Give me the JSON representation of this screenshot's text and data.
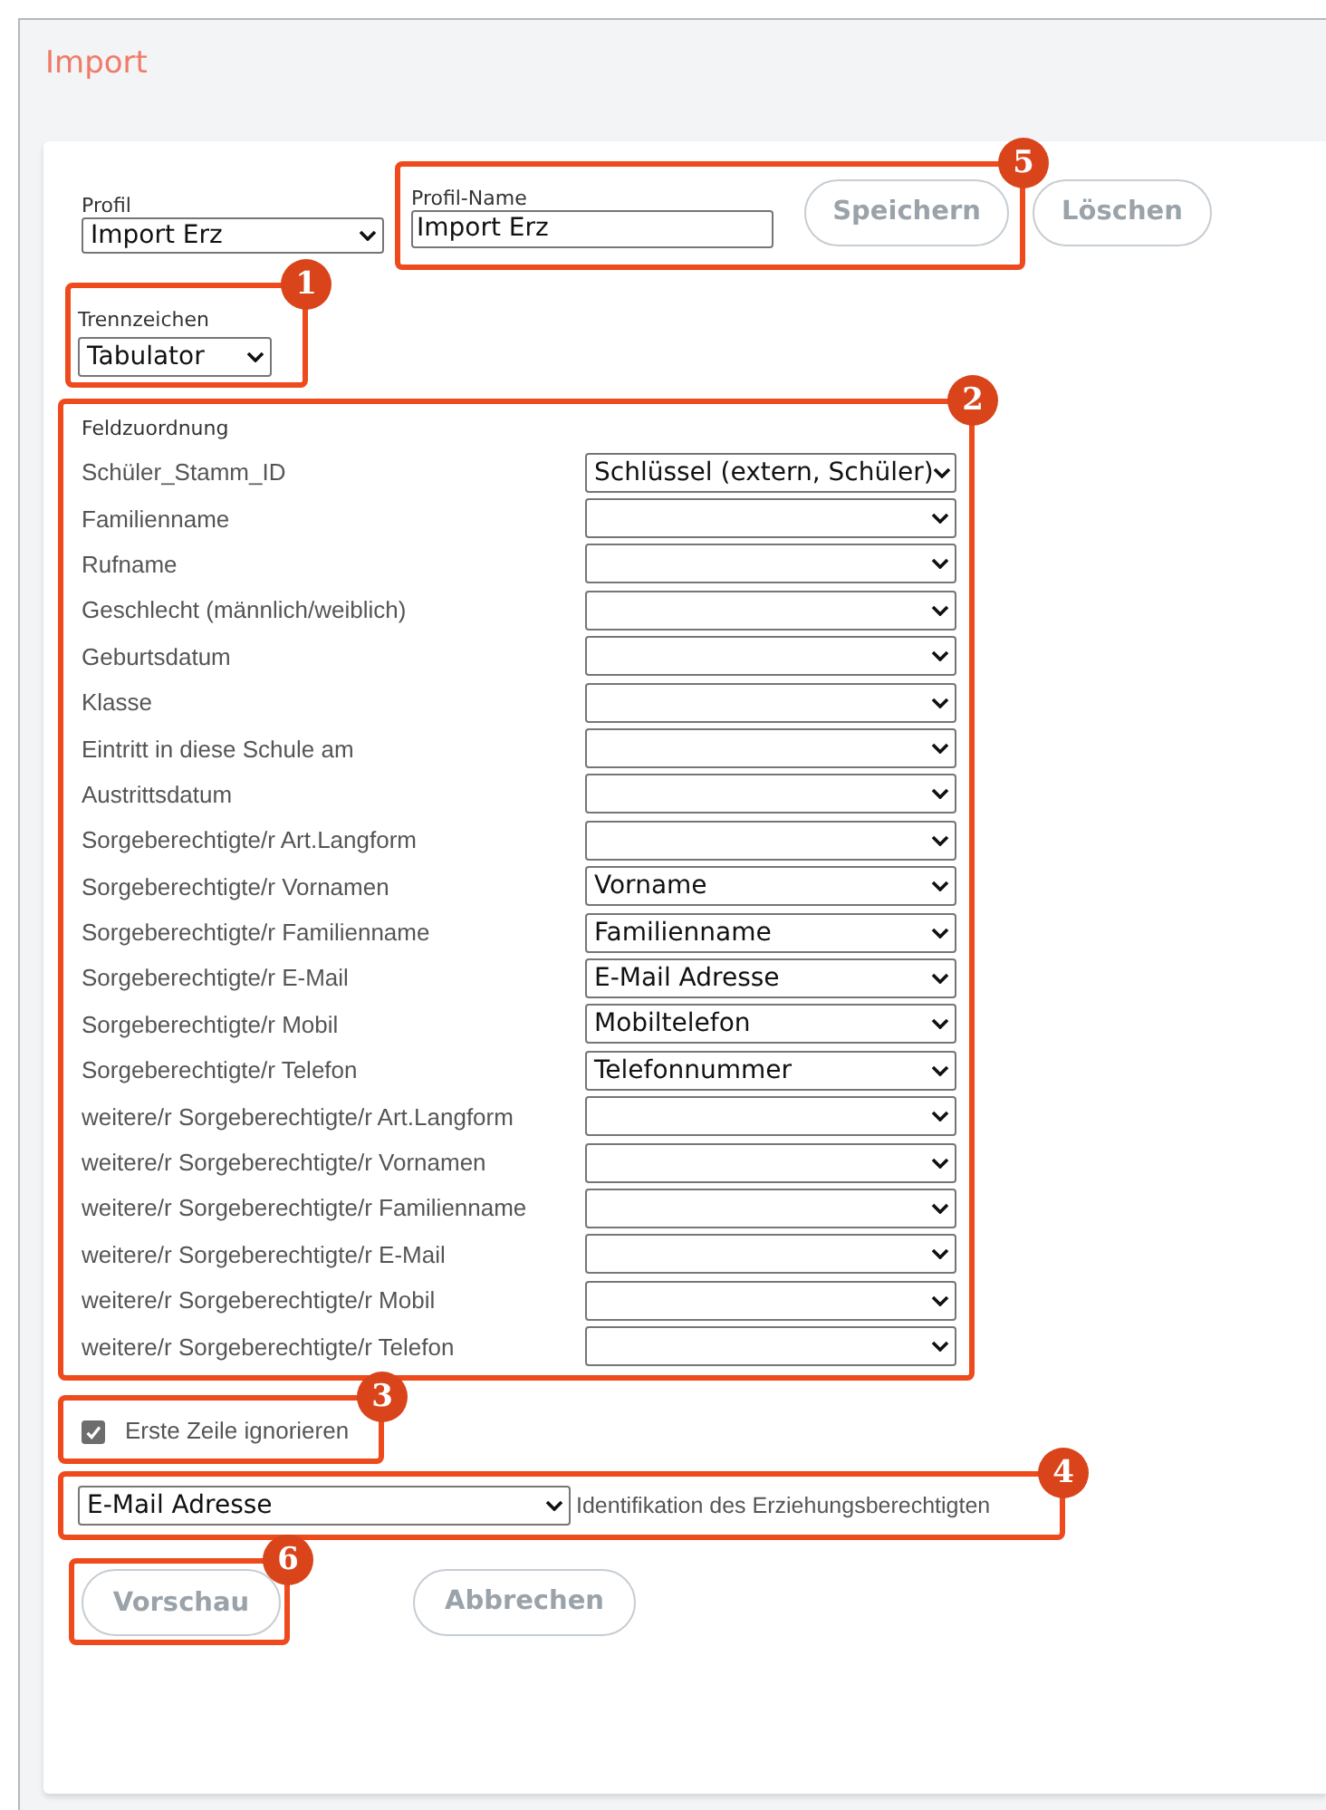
{
  "title": "Import",
  "profile": {
    "label": "Profil",
    "value": "Import Erz"
  },
  "profile_name": {
    "callout": "5",
    "label": "Profil-Name",
    "value": "Import Erz",
    "button": "Speichern"
  },
  "delete_button": "Löschen",
  "separator": {
    "callout": "1",
    "label": "Trennzeichen",
    "value": "Tabulator"
  },
  "field_mapping": {
    "callout": "2",
    "title": "Feldzuordnung",
    "rows": [
      {
        "label": "Schüler_Stamm_ID",
        "value": "Schlüssel (extern, Schüler)"
      },
      {
        "label": "Familienname"
      },
      {
        "label": "Rufname"
      },
      {
        "label": "Geschlecht (männlich/weiblich)"
      },
      {
        "label": "Geburtsdatum"
      },
      {
        "label": "Klasse"
      },
      {
        "label": "Eintritt in diese Schule am"
      },
      {
        "label": "Austrittsdatum"
      },
      {
        "label": "Sorgeberechtigte/r Art.Langform"
      },
      {
        "label": "Sorgeberechtigte/r Vornamen",
        "value": "Vorname"
      },
      {
        "label": "Sorgeberechtigte/r Familienname",
        "value": "Familienname"
      },
      {
        "label": "Sorgeberechtigte/r E-Mail",
        "value": "E-Mail Adresse"
      },
      {
        "label": "Sorgeberechtigte/r Mobil",
        "value": "Mobiltelefon"
      },
      {
        "label": "Sorgeberechtigte/r Telefon",
        "value": "Telefonnummer"
      },
      {
        "label": "weitere/r Sorgeberechtigte/r Art.Langform"
      },
      {
        "label": "weitere/r Sorgeberechtigte/r Vornamen"
      },
      {
        "label": "weitere/r Sorgeberechtigte/r Familienname"
      },
      {
        "label": "weitere/r Sorgeberechtigte/r E-Mail"
      },
      {
        "label": "weitere/r Sorgeberechtigte/r Mobil"
      },
      {
        "label": "weitere/r Sorgeberechtigte/r Telefon"
      }
    ]
  },
  "skip_first_row": {
    "callout": "3",
    "label": "Erste Zeile ignorieren",
    "checked": true
  },
  "identification": {
    "callout": "4",
    "value": "E-Mail Adresse",
    "label": "Identifikation des Erziehungsberechtigten"
  },
  "preview": {
    "callout": "6",
    "button": "Vorschau"
  },
  "cancel_button": "Abbrechen"
}
